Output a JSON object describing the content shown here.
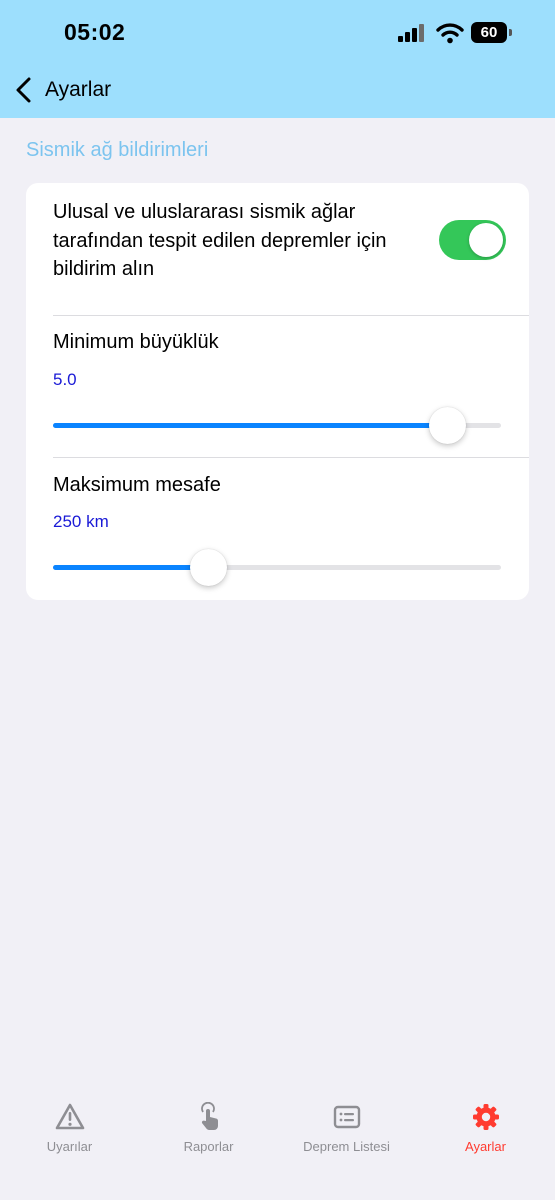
{
  "status_bar": {
    "time": "05:02",
    "battery": "60",
    "signal_icon": "cellular-signal-icon",
    "wifi_icon": "wifi-icon",
    "battery_icon": "battery-icon"
  },
  "nav": {
    "back_label": "Ayarlar",
    "back_icon": "chevron-left-icon",
    "background_color": "#9ddffd"
  },
  "section": {
    "header": "Sismik ağ bildirimleri"
  },
  "notification_toggle": {
    "label": "Ulusal ve uluslararası sismik ağlar tarafından tespit edilen depremler için bildirim alın",
    "enabled": true,
    "on_color": "#34c759"
  },
  "magnitude_slider": {
    "title": "Minimum büyüklük",
    "value_text": "5.0",
    "level": 0.88
  },
  "distance_slider": {
    "title": "Maksimum mesafe",
    "value_text": "250 km",
    "level": 0.345
  },
  "tabs": [
    {
      "label": "Uyarılar",
      "icon": "warning-triangle-icon",
      "active": false
    },
    {
      "label": "Raporlar",
      "icon": "tap-hand-icon",
      "active": false
    },
    {
      "label": "Deprem Listesi",
      "icon": "list-window-icon",
      "active": false
    },
    {
      "label": "Ayarlar",
      "icon": "gear-icon",
      "active": true
    }
  ],
  "colors": {
    "accent": "#0a84ff",
    "value_text": "#1a1ad6",
    "active_tab": "#ff3b30",
    "section_header": "#7cc4ef"
  }
}
